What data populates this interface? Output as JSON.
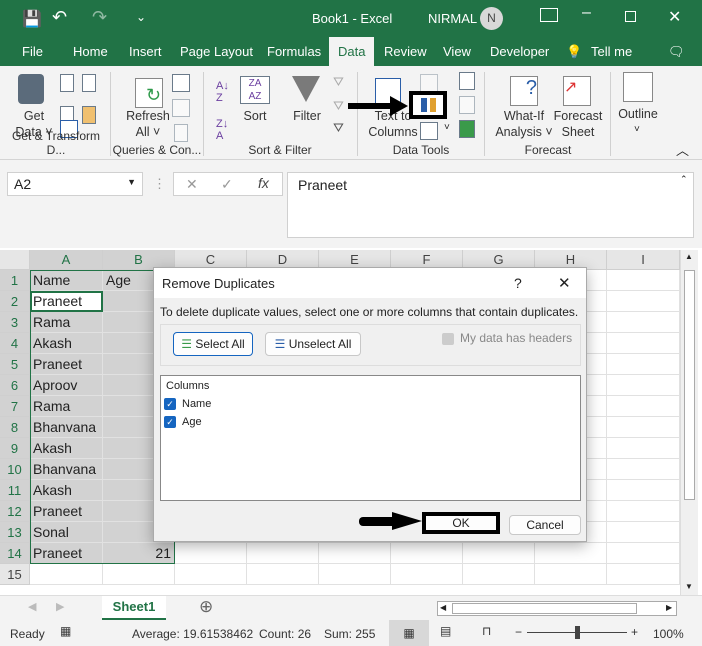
{
  "titlebar": {
    "title": "Book1  -  Excel",
    "user": "NIRMAL",
    "avatar": "N",
    "colors": {
      "brand": "#217346"
    }
  },
  "tabs": [
    "File",
    "Home",
    "Insert",
    "Page Layout",
    "Formulas",
    "Data",
    "Review",
    "View",
    "Developer",
    "Tell me"
  ],
  "active_tab": "Data",
  "ribbon": {
    "get_data": [
      "Get",
      "Data ˅"
    ],
    "refresh": [
      "Refresh",
      "All ˅"
    ],
    "sort": "Sort",
    "filter": "Filter",
    "text_to_columns": [
      "Text to",
      "Columns"
    ],
    "what_if": [
      "What-If",
      "Analysis ˅"
    ],
    "forecast_sheet": [
      "Forecast",
      "Sheet"
    ],
    "outline": "Outline",
    "groups": [
      "Get & Transform D...",
      "Queries & Con...",
      "Sort & Filter",
      "Data Tools",
      "Forecast"
    ]
  },
  "formula_bar": {
    "name_box": "A2",
    "fx": "fx",
    "value": "Praneet"
  },
  "columns": [
    "A",
    "B",
    "C",
    "D",
    "E",
    "F",
    "G",
    "H",
    "I"
  ],
  "rows": [
    "1",
    "2",
    "3",
    "4",
    "5",
    "6",
    "7",
    "8",
    "9",
    "10",
    "11",
    "12",
    "13",
    "14",
    "15"
  ],
  "cells": {
    "A": [
      "Name",
      "Praneet",
      "Rama",
      "Akash",
      "Praneet",
      "Aproov",
      "Rama",
      "Bhanvana",
      "Akash",
      "Bhanvana",
      "Akash",
      "Praneet",
      "Sonal",
      "Praneet"
    ],
    "B1": "Age",
    "B14": "21"
  },
  "dialog": {
    "title": "Remove Duplicates",
    "help": "?",
    "close": "✕",
    "instruction": "To delete duplicate values, select one or more columns that contain duplicates.",
    "select_all": "Select All",
    "unselect_all": "Unselect All",
    "has_headers": "My data has headers",
    "columns_header": "Columns",
    "columns": [
      {
        "label": "Name",
        "checked": true
      },
      {
        "label": "Age",
        "checked": true
      }
    ],
    "ok": "OK",
    "cancel": "Cancel"
  },
  "sheet_tabs": {
    "active": "Sheet1",
    "add": "⊕"
  },
  "status": {
    "ready": "Ready",
    "average": "Average: 19.61538462",
    "count": "Count: 26",
    "sum": "Sum: 255",
    "zoom": "100%",
    "zoom_level": 100
  }
}
